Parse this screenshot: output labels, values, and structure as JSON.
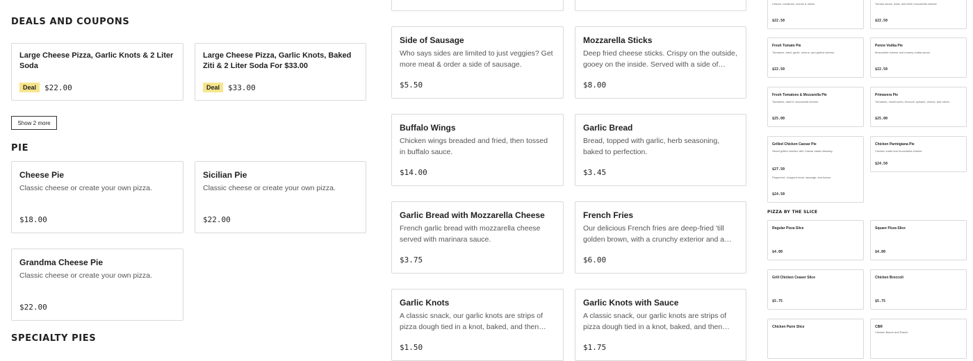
{
  "deals": {
    "title": "Deals and Coupons",
    "items": [
      {
        "name": "Large Cheese Pizza, Garlic Knots & 2 Liter Soda",
        "badge": "Deal",
        "price": "$22.00"
      },
      {
        "name": "Large Cheese Pizza, Garlic Knots, Baked Ziti & 2 Liter Soda For $33.00",
        "badge": "Deal",
        "price": "$33.00"
      }
    ],
    "show_more": "Show 2 more"
  },
  "pie": {
    "title": "Pie",
    "items": [
      {
        "name": "Cheese Pie",
        "desc": "Classic cheese or create your own pizza.",
        "price": "$18.00"
      },
      {
        "name": "Sicilian Pie",
        "desc": "Classic cheese or create your own pizza.",
        "price": "$22.00"
      },
      {
        "name": "Grandma Cheese Pie",
        "desc": "Classic cheese or create your own pizza.",
        "price": "$22.00"
      }
    ]
  },
  "specialty": {
    "title": "Specialty Pies"
  },
  "sides": {
    "items": [
      {
        "name": "Side of Sausage",
        "desc": "Who says sides are limited to just veggies? Get more meat & order a side of sausage.",
        "price": "$5.50"
      },
      {
        "name": "Mozzarella Sticks",
        "desc": "Deep fried cheese sticks. Crispy on the outside, gooey on the inside. Served with a side of marinara sauce.",
        "price": "$8.00"
      },
      {
        "name": "Buffalo Wings",
        "desc": "Chicken wings breaded and fried, then tossed in buffalo sauce.",
        "price": "$14.00"
      },
      {
        "name": "Garlic Bread",
        "desc": "Bread, topped with garlic, herb seasoning, baked to perfection.",
        "price": "$3.45"
      },
      {
        "name": "Garlic Bread with Mozzarella Cheese",
        "desc": "French garlic bread with mozzarella cheese served with marinara sauce.",
        "price": "$3.75"
      },
      {
        "name": "French Fries",
        "desc": "Our delicious French fries are deep-fried 'till golden brown, with a crunchy exterior and a light fluffy interior.",
        "price": "$6.00"
      },
      {
        "name": "Garlic Knots",
        "desc": "A classic snack, our garlic knots are strips of pizza dough tied in a knot, baked, and then topped with garlic.",
        "price": "$1.50"
      },
      {
        "name": "Garlic Knots with Sauce",
        "desc": "A classic snack, our garlic knots are strips of pizza dough tied in a knot, baked, and then topped with garlic.",
        "price": "$1.75"
      }
    ]
  },
  "right": {
    "top_cards": [
      {
        "desc": "Lettuce, tomatoes, onions & olives.",
        "price": "$22.50"
      },
      {
        "desc": "Tomato sauce, basil, and fresh mozzarella cheese.",
        "price": "$22.50"
      }
    ],
    "cards": [
      {
        "name": "Fresh Tomato Pie",
        "desc": "Tomatoes, basil, garlic, onions, and grated cheese.",
        "price": "$22.50"
      },
      {
        "name": "Penne Vodka Pie",
        "desc": "Mozzarella cheese and creamy vodka sauce.",
        "price": "$22.50"
      },
      {
        "name": "Fresh Tomatoes & Mozzarella Pie",
        "desc": "Tomatoes, basil & mozzarella cheese.",
        "price": "$25.00"
      },
      {
        "name": "Primavera Pie",
        "desc": "Tomatoes, mushrooms, broccoli, spinach, onions, and olives.",
        "price": "$25.00"
      },
      {
        "name": "Grilled Chicken Caesar Pie",
        "desc": "Sliced grilled chicken with Caesar salad dressing.",
        "price": "$27.50"
      },
      {
        "name": "Chicken Parmigiana Pie",
        "desc": "Chicken cutlet and mozzarella cheese.",
        "price": "$24.50"
      }
    ],
    "overflow_card": {
      "desc": "Pepperoni, chopped meat, sausage, and bacon.",
      "price": "$24.50"
    },
    "slice_title": "Pizza by the Slice",
    "slice_cards": [
      {
        "name": "Regular Pizza Slice",
        "desc": "",
        "price": "$4.00"
      },
      {
        "name": "Square Pizza Slice",
        "desc": "",
        "price": "$4.00"
      },
      {
        "name": "Grill Chicken Ceaser Slice",
        "desc": "",
        "price": "$5.75"
      },
      {
        "name": "Chicken Broccoli",
        "desc": "",
        "price": "$5.75"
      },
      {
        "name": "Chicken Parm Slice",
        "desc": "",
        "price": ""
      },
      {
        "name": "CBR",
        "desc": "Chicken Bacon and Ranch",
        "price": ""
      }
    ]
  }
}
